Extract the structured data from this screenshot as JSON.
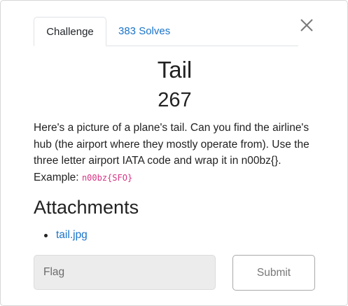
{
  "tabs": [
    {
      "label": "Challenge",
      "active": true
    },
    {
      "label": "383 Solves",
      "active": false
    }
  ],
  "close_icon": "close-icon",
  "challenge": {
    "name": "Tail",
    "points": "267",
    "description": "Here's a picture of a plane's tail. Can you find the airline's hub (the airport where they mostly operate from). Use the three letter airport IATA code and wrap it in n00bz{}.",
    "example_label": "Example:",
    "example_code": "n00bz{SFO}"
  },
  "attachments": {
    "heading": "Attachments",
    "files": [
      "tail.jpg"
    ]
  },
  "flag_input": {
    "placeholder": "Flag",
    "value": ""
  },
  "submit_label": "Submit",
  "colors": {
    "link": "#1a73c8",
    "code": "#d63384",
    "input_bg": "#ececec"
  }
}
